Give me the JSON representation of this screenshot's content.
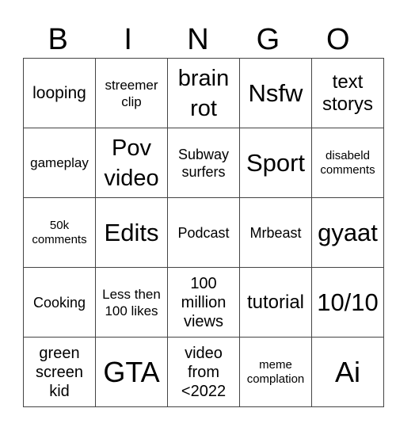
{
  "header": [
    "B",
    "I",
    "N",
    "G",
    "O"
  ],
  "cells": [
    [
      "looping",
      "streemer clip",
      "brain rot",
      "Nsfw",
      "text storys"
    ],
    [
      "gameplay",
      "Pov video",
      "Subway surfers",
      "Sport",
      "disabeld comments"
    ],
    [
      "50k comments",
      "Edits",
      "Podcast",
      "Mrbeast",
      "gyaat"
    ],
    [
      "Cooking",
      "Less then 100 likes",
      "100 million views",
      "tutorial",
      "10/10"
    ],
    [
      "green screen kid",
      "GTA",
      "video from <2022",
      "meme complation",
      "Ai"
    ]
  ]
}
